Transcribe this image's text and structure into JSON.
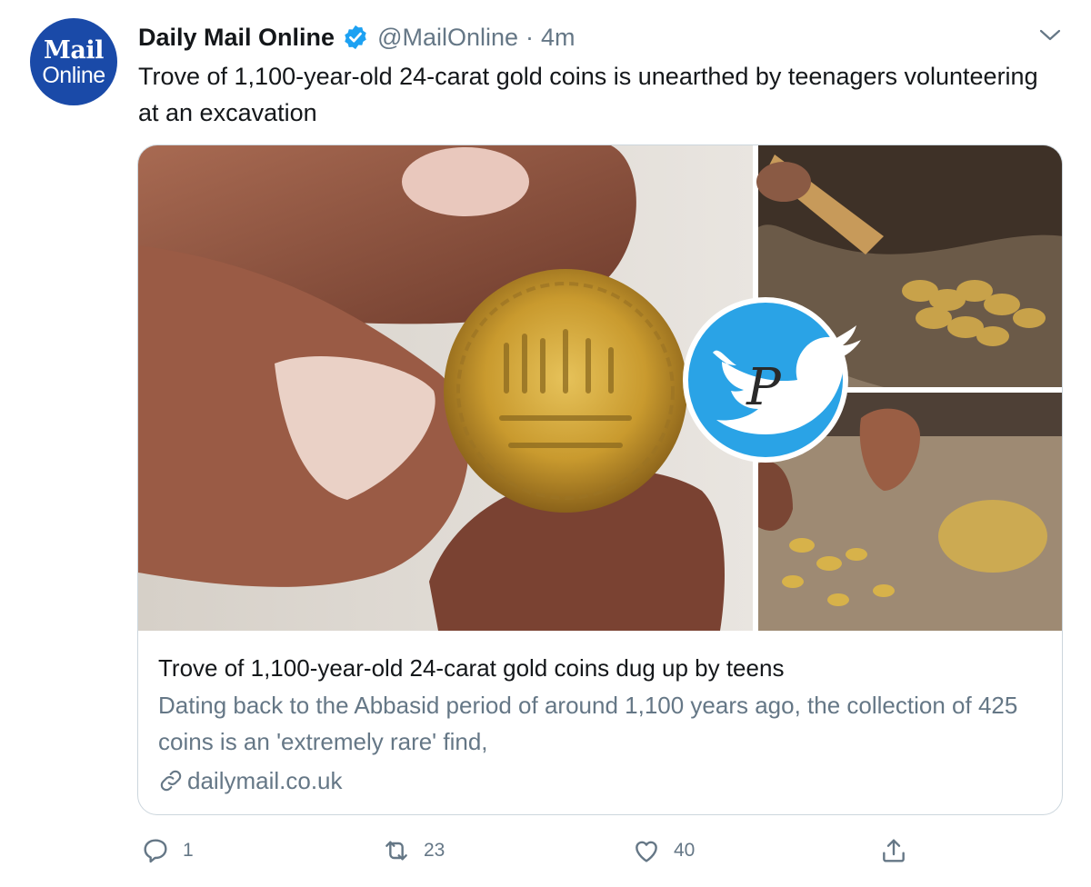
{
  "tweet": {
    "avatar": {
      "line1": "Mail",
      "line2": "Online",
      "color": "#1a4aa8"
    },
    "author_name": "Daily Mail Online",
    "verified_icon": "verified-badge-icon",
    "handle": "@MailOnline",
    "separator": "·",
    "time": "4m",
    "text": "Trove of 1,100-year-old 24-carat gold coins is unearthed by teenagers volunteering at an excavation"
  },
  "card": {
    "title": "Trove of 1,100-year-old 24-carat gold coins dug up by teens",
    "description": "Dating back to the Abbasid period of around 1,100 years ago, the collection of 425 coins is an 'extremely rare' find,",
    "domain": "dailymail.co.uk",
    "watermark_icon": "twitter-bird-icon"
  },
  "actions": {
    "reply_count": "1",
    "retweet_count": "23",
    "like_count": "40"
  },
  "colors": {
    "accent": "#1da1f2",
    "secondary_text": "#657786",
    "border": "#ccd6dd"
  }
}
